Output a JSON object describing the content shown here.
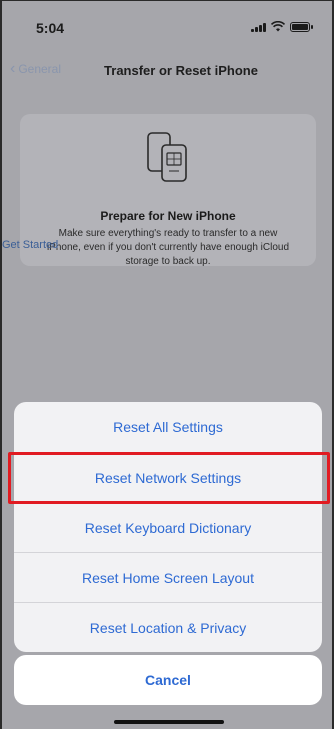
{
  "status_bar": {
    "time": "5:04"
  },
  "nav": {
    "back_label": "General",
    "title": "Transfer or Reset iPhone"
  },
  "card": {
    "title": "Prepare for New iPhone",
    "description": "Make sure everything's ready to transfer to a new iPhone, even if you don't currently have enough iCloud storage to back up.",
    "link": "Get Started"
  },
  "sheet": {
    "items": [
      {
        "label": "Reset All Settings"
      },
      {
        "label": "Reset Network Settings"
      },
      {
        "label": "Reset Keyboard Dictionary"
      },
      {
        "label": "Reset Home Screen Layout"
      },
      {
        "label": "Reset Location & Privacy"
      }
    ],
    "cancel": "Cancel"
  },
  "colors": {
    "accent": "#2e6ad3",
    "highlight": "#e11b22"
  }
}
